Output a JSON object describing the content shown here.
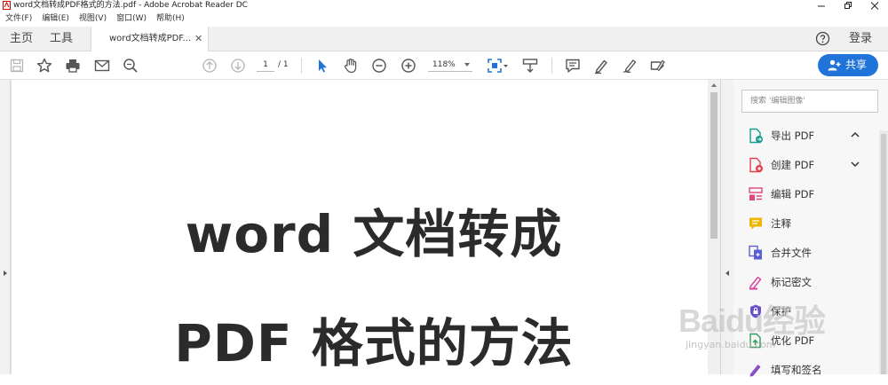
{
  "window": {
    "title": "word文档转成PDF格式的方法.pdf - Adobe Acrobat Reader DC"
  },
  "menu": [
    "文件(F)",
    "编辑(E)",
    "视图(V)",
    "窗口(W)",
    "帮助(H)"
  ],
  "tabs": {
    "home": "主页",
    "tools": "工具",
    "document": "word文档转成PDF...",
    "login": "登录"
  },
  "toolbar": {
    "page_current": "1",
    "page_total": "/ 1",
    "zoom": "118%",
    "share_label": "共享"
  },
  "document": {
    "line1": "word 文档转成",
    "line2": "PDF 格式的方法"
  },
  "tools_pane": {
    "search_placeholder": "搜索 '编辑图像'",
    "items": [
      {
        "label": "导出 PDF",
        "icon": "export-pdf-icon",
        "color": "#1a9e8f"
      },
      {
        "label": "创建 PDF",
        "icon": "create-pdf-icon",
        "color": "#e2404f"
      },
      {
        "label": "编辑 PDF",
        "icon": "edit-pdf-icon",
        "color": "#e0457b"
      },
      {
        "label": "注释",
        "icon": "comment-icon",
        "color": "#f0b400"
      },
      {
        "label": "合并文件",
        "icon": "combine-files-icon",
        "color": "#5b5fd6"
      },
      {
        "label": "标记密文",
        "icon": "redact-icon",
        "color": "#d9429e"
      },
      {
        "label": "保护",
        "icon": "protect-icon",
        "color": "#6a4fd0"
      },
      {
        "label": "优化 PDF",
        "icon": "optimize-pdf-icon",
        "color": "#2f9e5c"
      },
      {
        "label": "填写和签名",
        "icon": "fill-sign-icon",
        "color": "#8a4fc8"
      }
    ]
  },
  "watermark": {
    "logo": "Baidu经验",
    "sub": "jingyan.baidu.com"
  },
  "colors": {
    "accent": "#1f73d9",
    "toolbar_icon": "#555555",
    "select_tool": "#1f73d9"
  }
}
